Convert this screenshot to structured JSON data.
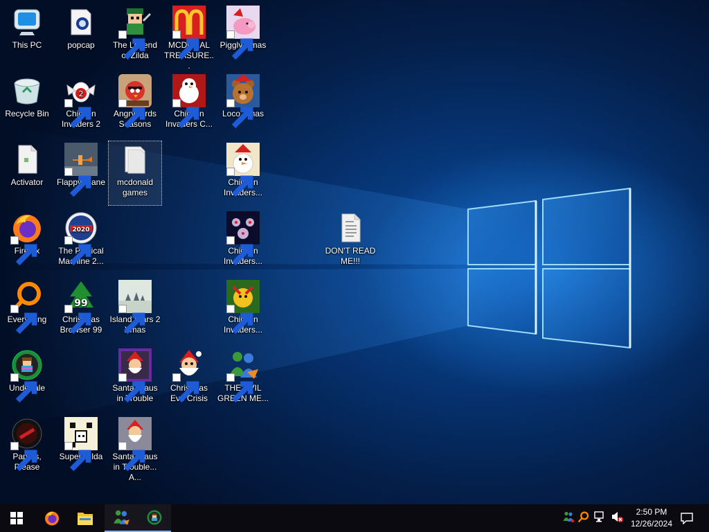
{
  "desktop_icons": [
    {
      "label": "This PC",
      "icon": "computer-icon"
    },
    {
      "label": "popcap",
      "icon": "folder-icon"
    },
    {
      "label": "The Legend of Zilda",
      "icon": "zilda-game-icon"
    },
    {
      "label": "MCDONAL TREASURE...",
      "icon": "mcdonalds-icon"
    },
    {
      "label": "Piggly Xmas",
      "icon": "piggly-icon"
    },
    {
      "label": "Recycle Bin",
      "icon": "recycle-bin-icon"
    },
    {
      "label": "Chicken Invaders 2",
      "icon": "chicken-invaders-icon"
    },
    {
      "label": "Angry Birds Seasons",
      "icon": "angry-birds-icon"
    },
    {
      "label": "Chicken Invaders C...",
      "icon": "chicken-invaders-snowman-icon"
    },
    {
      "label": "Loco Xmas",
      "icon": "loco-bear-icon"
    },
    {
      "label": "Activator",
      "icon": "file-icon"
    },
    {
      "label": "Flappy Plane",
      "icon": "flappy-plane-icon"
    },
    {
      "label": "mcdonald games",
      "icon": "folder-icon"
    },
    {
      "label": "Chicken Invaders...",
      "icon": "chicken-invaders-icon"
    },
    {
      "label": "Firefox",
      "icon": "firefox-icon"
    },
    {
      "label": "The Political Machine 2...",
      "icon": "political-machine-icon"
    },
    {
      "label": "Chicken Invaders...",
      "icon": "chicken-invaders-icon"
    },
    {
      "label": "DON'T READ ME!!!",
      "icon": "text-file-icon"
    },
    {
      "label": "Everything",
      "icon": "everything-search-icon"
    },
    {
      "label": "Christmas Browser 99",
      "icon": "christmas-tree-icon"
    },
    {
      "label": "Island Wars 2 Xmas",
      "icon": "island-wars-icon"
    },
    {
      "label": "Chicken Invaders...",
      "icon": "chicken-invaders-icon"
    },
    {
      "label": "Undertale",
      "icon": "undertale-icon"
    },
    {
      "label": "Santa Claus in Trouble",
      "icon": "santa-icon"
    },
    {
      "label": "Christmas Eve Crisis",
      "icon": "santa-icon"
    },
    {
      "label": "THE EVIL GREEN ME...",
      "icon": "messenger-icon"
    },
    {
      "label": "Papers, Please",
      "icon": "papers-please-icon"
    },
    {
      "label": "Super Hilda",
      "icon": "super-hilda-icon"
    },
    {
      "label": "Santa Claus in Trouble... A...",
      "icon": "santa-icon"
    }
  ],
  "taskbar": {
    "start_icon": "windows-start-icon",
    "pinned": [
      "firefox-icon",
      "file-explorer-icon",
      "messenger-icon",
      "undertale-icon"
    ],
    "tray_icons": [
      "messenger-tray-icon",
      "everything-tray-icon",
      "network-icon",
      "volume-muted-icon"
    ],
    "clock_time": "2:50 PM",
    "clock_date": "12/26/2024",
    "notification_icon": "notification-icon"
  },
  "colors": {
    "taskbar": "#0a0a10",
    "wallpaper_blue": "#0a4d9e",
    "window_glow": "#7fd0ff"
  }
}
